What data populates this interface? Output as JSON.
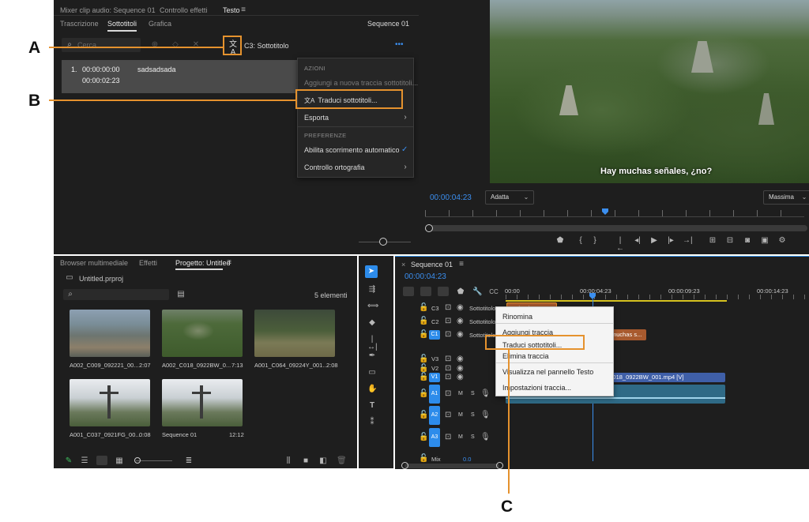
{
  "callouts": {
    "a": "A",
    "b": "B",
    "c": "C"
  },
  "text_panel": {
    "top_tabs": [
      "Mixer clip audio: Sequence 01",
      "Controllo effetti",
      "Testo"
    ],
    "sub_tabs": [
      "Trascrizione",
      "Sottotitoli",
      "Grafica"
    ],
    "sequence_name": "Sequence 01",
    "search_placeholder": "Cerca",
    "track_label": "C3: Sottotitolo",
    "more_label": "•••",
    "caption": {
      "index": "1.",
      "in_time": "00:00:00:00",
      "out_time": "00:00:02:23",
      "text": "sadsadsada"
    }
  },
  "actions_menu": {
    "section_actions": "AZIONI",
    "add_track": "Aggiungi a nuova traccia sottotitoli...",
    "translate": "Traduci sottotitoli...",
    "export": "Esporta",
    "section_prefs": "PREFERENZE",
    "autoscroll": "Abilita scorrimento automatico",
    "spellcheck": "Controllo ortografia"
  },
  "program_monitor": {
    "subtitle": "Hay muchas señales, ¿no?",
    "timecode": "00:00:04:23",
    "fit": "Adatta",
    "quality": "Massima"
  },
  "project_panel": {
    "tabs": [
      "Browser multimediale",
      "Effetti",
      "Progetto: Untitled"
    ],
    "project_file": "Untitled.prproj",
    "item_count": "5 elementi",
    "items": [
      {
        "name": "A002_C009_092221_00...",
        "duration": "2:07"
      },
      {
        "name": "A002_C018_0922BW_0...",
        "duration": "7:13"
      },
      {
        "name": "A001_C064_09224Y_001...",
        "duration": "2:08"
      },
      {
        "name": "A001_C037_0921FG_00...",
        "duration": "0:08"
      },
      {
        "name": "Sequence 01",
        "duration": "12:12"
      }
    ]
  },
  "timeline": {
    "tab": "Sequence 01",
    "timecode": "00:00:04:23",
    "ruler": [
      "00:00",
      "00:00:04:23",
      "00:00:09:23",
      "00:00:14:23"
    ],
    "tracks": [
      "C3",
      "C2",
      "C1",
      "V3",
      "V2",
      "V1",
      "A1",
      "A2",
      "A3"
    ],
    "subtitle_track_name": "Sottotitolo",
    "caption_clip_1": "sadsads",
    "caption_clip_2": "muchas s...",
    "video_clip": "C018_0922BW_001.mp4 [V]",
    "mix_label": "Mix",
    "mix_value": "0.0"
  },
  "track_context_menu": {
    "rename": "Rinomina",
    "add_track": "Aggiungi traccia",
    "translate": "Traduci sottotitoli...",
    "delete": "Elimina traccia",
    "show_in_text": "Visualizza nel pannello Testo",
    "settings": "Impostazioni traccia..."
  },
  "colors": {
    "accent_orange": "#e5922e",
    "blue": "#2d8ceb",
    "caption_clip": "#a85a2e"
  }
}
